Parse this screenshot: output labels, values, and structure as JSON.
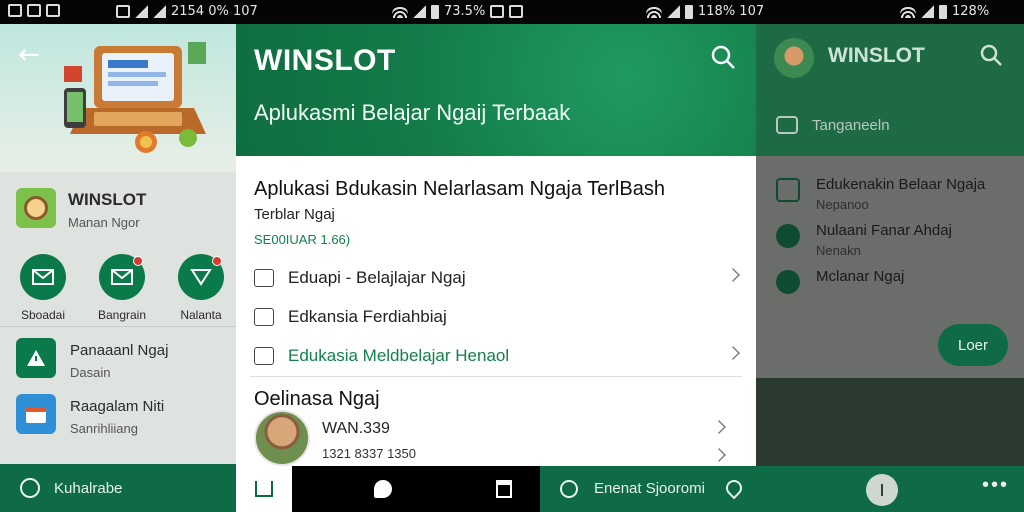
{
  "statusbar": {
    "left_text": "2154 0% 107",
    "mid_text": "73.5%",
    "right_mid_text": "118% 107",
    "right_text": "128%"
  },
  "panel_left": {
    "app_title": "WINSLOT",
    "app_subtitle": "Manan Ngor",
    "categories": [
      {
        "label": "Sboadai"
      },
      {
        "label": "Bangrain"
      },
      {
        "label": "Nalanta"
      }
    ],
    "list": [
      {
        "title": "Panaaanl Ngaj",
        "subtitle": "Dasain"
      },
      {
        "title": "Raagalam Niti",
        "subtitle": "Sanrihliiang"
      }
    ],
    "bottom_label": "Kuhalrabe"
  },
  "panel_main": {
    "brand": "WINSLOT",
    "header_subtitle": "Aplukasmi Belajar Ngaij Terbaak",
    "app_title": "Aplukasi Bdukasin Nelarlasam Ngaja TerlBash",
    "tagline": "Terblar Ngaj",
    "version": "SE00IUAR 1.66)",
    "rows": [
      {
        "label": "Eduapi - Belajlajar Ngaj"
      },
      {
        "label": "Edkansia Ferdiahbiaj"
      },
      {
        "label": "Edukasia Meldbelajar Henaol"
      }
    ],
    "section_title": "Oelinasa Ngaj",
    "user": {
      "name": "WAN.339",
      "phone": "1321 8337 1350"
    }
  },
  "panel_right": {
    "brand": "WINSLOT",
    "field_label": "Tanganeeln",
    "items": [
      {
        "title": "Edukenakin Belaar Ngaja",
        "subtitle": "Nepanoo"
      },
      {
        "title": "Nulaani Fanar Ahdaj",
        "subtitle": "Nenakn"
      },
      {
        "title": "Mclanar Ngaj",
        "subtitle": ""
      }
    ],
    "button_label": "Loer",
    "bottom_search": "Enenat Sjooromi"
  },
  "colors": {
    "primary_green": "#0e6b45",
    "header_green": "#137a48",
    "accent_text_green": "#14804a"
  }
}
